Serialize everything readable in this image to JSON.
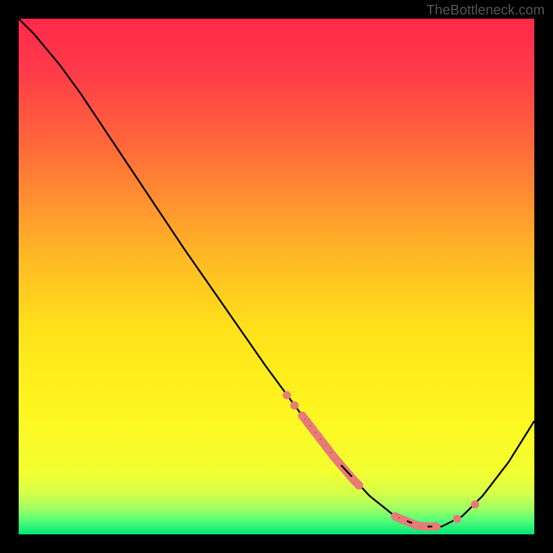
{
  "attribution": "TheBottleneck.com",
  "chart_data": {
    "type": "line",
    "title": "",
    "xlabel": "",
    "ylabel": "",
    "xlim": [
      0,
      100
    ],
    "ylim": [
      0,
      100
    ],
    "gradient_stops": [
      {
        "offset": 0.0,
        "color": "#ff2a4b"
      },
      {
        "offset": 0.1,
        "color": "#ff3a49"
      },
      {
        "offset": 0.25,
        "color": "#ff6a3a"
      },
      {
        "offset": 0.45,
        "color": "#ffb526"
      },
      {
        "offset": 0.6,
        "color": "#ffe11a"
      },
      {
        "offset": 0.75,
        "color": "#fff51e"
      },
      {
        "offset": 0.88,
        "color": "#f3ff30"
      },
      {
        "offset": 0.92,
        "color": "#d5ff4a"
      },
      {
        "offset": 0.95,
        "color": "#a0ff60"
      },
      {
        "offset": 0.97,
        "color": "#5fff78"
      },
      {
        "offset": 1.0,
        "color": "#00e878"
      }
    ],
    "curve": [
      {
        "x": 0.0,
        "y": 100.0
      },
      {
        "x": 3.0,
        "y": 97.0
      },
      {
        "x": 8.0,
        "y": 91.0
      },
      {
        "x": 12.0,
        "y": 85.5
      },
      {
        "x": 18.0,
        "y": 76.5
      },
      {
        "x": 25.0,
        "y": 66.0
      },
      {
        "x": 32.0,
        "y": 55.5
      },
      {
        "x": 40.0,
        "y": 44.0
      },
      {
        "x": 48.0,
        "y": 32.5
      },
      {
        "x": 55.0,
        "y": 23.0
      },
      {
        "x": 62.0,
        "y": 14.0
      },
      {
        "x": 68.0,
        "y": 7.5
      },
      {
        "x": 73.0,
        "y": 3.5
      },
      {
        "x": 78.0,
        "y": 1.5
      },
      {
        "x": 82.0,
        "y": 1.5
      },
      {
        "x": 86.0,
        "y": 3.5
      },
      {
        "x": 90.0,
        "y": 7.5
      },
      {
        "x": 95.0,
        "y": 14.0
      },
      {
        "x": 100.0,
        "y": 22.0
      }
    ],
    "markers": [
      {
        "x": 52.0,
        "y": 27.0
      },
      {
        "x": 53.5,
        "y": 25.0
      },
      {
        "x": 55.0,
        "y": 23.0
      },
      {
        "x": 56.0,
        "y": 21.7
      },
      {
        "x": 57.0,
        "y": 20.4
      },
      {
        "x": 58.0,
        "y": 19.1
      },
      {
        "x": 59.0,
        "y": 17.8
      },
      {
        "x": 60.0,
        "y": 16.5
      },
      {
        "x": 61.0,
        "y": 15.2
      },
      {
        "x": 62.0,
        "y": 14.0
      },
      {
        "x": 65.0,
        "y": 10.5
      },
      {
        "x": 66.0,
        "y": 9.5
      },
      {
        "x": 73.0,
        "y": 3.5
      },
      {
        "x": 74.5,
        "y": 2.8
      },
      {
        "x": 77.0,
        "y": 1.8
      },
      {
        "x": 78.5,
        "y": 1.5
      },
      {
        "x": 81.0,
        "y": 1.5
      },
      {
        "x": 85.0,
        "y": 3.0
      },
      {
        "x": 88.5,
        "y": 5.8
      }
    ],
    "marker_style": {
      "color": "#e87a78",
      "radius": 6
    },
    "marker_segments": [
      {
        "from": 2,
        "to": 11
      },
      {
        "from": 12,
        "to": 16
      }
    ]
  }
}
